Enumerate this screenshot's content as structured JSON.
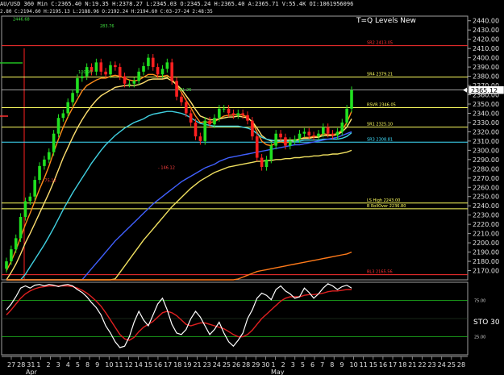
{
  "header": {
    "title_line": "AU/USD 360 Min  C:2365.40  N:19.35  H:2378.27  L:2345.03  O:2345.24  H:2365.40  A:2365.71  V:55.4K  OI:1061956096",
    "info_line": "2.80  C:2194.60  H:2195.13  L:2188.96  O:2192.24  H:2194.60  C:03-27-24  2:48:35"
  },
  "chart_data": {
    "type": "candlestick",
    "title": "T=Q Levels New",
    "instrument": "AU/USD",
    "timeframe": "360 Min",
    "ylim": [
      2160,
      2445
    ],
    "y_ticks": [
      2170,
      2180,
      2190,
      2200,
      2210,
      2220,
      2230,
      2240,
      2250,
      2260,
      2270,
      2280,
      2290,
      2300,
      2310,
      2320,
      2330,
      2340,
      2350,
      2360,
      2370,
      2380,
      2390,
      2400,
      2410,
      2420,
      2430,
      2440
    ],
    "last_price": "2365.12",
    "x_tick_labels": [
      "27",
      "28",
      "31",
      "1",
      "2",
      "3",
      "4",
      "5",
      "8",
      "9",
      "10",
      "11",
      "12",
      "14",
      "15",
      "16",
      "17",
      "18",
      "19",
      "21",
      "23",
      "24",
      "25",
      "26",
      "28",
      "29",
      "30",
      "1",
      "2",
      "3",
      "5",
      "6",
      "7",
      "8",
      "9",
      "10",
      "11",
      "15",
      "16",
      "17",
      "18",
      "21",
      "22",
      "23",
      "24",
      "25",
      "28"
    ],
    "month_labels": [
      "Apr",
      "May"
    ],
    "levels": [
      {
        "label": "SR2 2413.05",
        "value": 2413.05,
        "color": "#ff3030"
      },
      {
        "label": "SR4 2379.21",
        "value": 2379.21,
        "color": "#ffff60"
      },
      {
        "label": "RSVR 2346.05",
        "value": 2346.05,
        "color": "#ffff60"
      },
      {
        "label": "SR1 2325.10",
        "value": 2325.1,
        "color": "#ffff60"
      },
      {
        "label": "SR3 2308.81",
        "value": 2308.81,
        "color": "#40e0ff"
      },
      {
        "label": "LS High 2243.00",
        "value": 2243.0,
        "color": "#ffff60"
      },
      {
        "label": "B RollOver 2236.80",
        "value": 2236.8,
        "color": "#ffff60"
      },
      {
        "label": "BL3 2165.56",
        "value": 2165.56,
        "color": "#ff3030"
      }
    ],
    "annotations": [
      {
        "text": "2446.68",
        "x": "27",
        "y": 2440
      },
      {
        "text": "283.76",
        "x": "12",
        "y": 2433
      },
      {
        "text": "100.90",
        "x": "9",
        "y": 2383
      },
      {
        "text": "81.26",
        "x": "26",
        "y": 2364
      },
      {
        "text": "- 146.12",
        "x": "23",
        "y": 2280
      },
      {
        "text": "- 75.13",
        "x": "2",
        "y": 2266
      }
    ],
    "price_series": [
      {
        "name": "close",
        "values": [
          2180,
          2193,
          2205,
          2228,
          2245,
          2250,
          2268,
          2283,
          2290,
          2298,
          2318,
          2335,
          2340,
          2352,
          2362,
          2378,
          2380,
          2390,
          2385,
          2395,
          2385,
          2382,
          2392,
          2390,
          2380,
          2372,
          2372,
          2375,
          2385,
          2391,
          2400,
          2390,
          2382,
          2388,
          2395,
          2375,
          2358,
          2352,
          2340,
          2330,
          2315,
          2310,
          2332,
          2328,
          2335,
          2345,
          2345,
          2340,
          2338,
          2340,
          2338,
          2332,
          2315,
          2292,
          2282,
          2290,
          2305,
          2318,
          2314,
          2305,
          2310,
          2312,
          2318,
          2320,
          2316,
          2315,
          2318,
          2325,
          2318,
          2316,
          2320,
          2330,
          2345,
          2365
        ]
      }
    ],
    "moving_averages": [
      {
        "values": [
          2170,
          2180,
          2192,
          2206,
          2220,
          2232,
          2245,
          2258,
          2270,
          2283,
          2298,
          2312,
          2325,
          2336,
          2346,
          2355,
          2364,
          2370,
          2373,
          2376,
          2378,
          2378,
          2380,
          2381,
          2380,
          2378,
          2376,
          2375,
          2376,
          2379,
          2382,
          2382,
          2380,
          2380,
          2381,
          2377,
          2370,
          2363,
          2354,
          2346,
          2337,
          2330,
          2331,
          2330,
          2331,
          2334,
          2337,
          2338,
          2338,
          2339,
          2338,
          2336,
          2330,
          2320,
          2310,
          2306,
          2305,
          2308,
          2309,
          2308,
          2309,
          2310,
          2312,
          2314,
          2314,
          2315,
          2315,
          2318,
          2317,
          2317,
          2318,
          2322,
          2330,
          2342
        ],
        "color": "#ff8c1a"
      },
      {
        "values": [
          2160,
          2168,
          2177,
          2188,
          2200,
          2210,
          2221,
          2232,
          2243,
          2254,
          2266,
          2279,
          2292,
          2303,
          2314,
          2324,
          2333,
          2341,
          2348,
          2354,
          2359,
          2362,
          2365,
          2368,
          2369,
          2370,
          2370,
          2370,
          2371,
          2373,
          2376,
          2377,
          2377,
          2377,
          2378,
          2375,
          2371,
          2366,
          2359,
          2352,
          2344,
          2337,
          2335,
          2333,
          2333,
          2334,
          2335,
          2336,
          2336,
          2337,
          2336,
          2335,
          2331,
          2324,
          2316,
          2312,
          2310,
          2311,
          2311,
          2311,
          2311,
          2311,
          2312,
          2313,
          2313,
          2314,
          2314,
          2316,
          2316,
          2316,
          2317,
          2320,
          2325,
          2334
        ],
        "color": "#ffe070"
      },
      {
        "values": [
          2140,
          2145,
          2151,
          2158,
          2166,
          2174,
          2182,
          2190,
          2198,
          2207,
          2216,
          2226,
          2236,
          2245,
          2254,
          2262,
          2270,
          2278,
          2286,
          2293,
          2300,
          2306,
          2311,
          2316,
          2320,
          2324,
          2327,
          2330,
          2332,
          2334,
          2337,
          2339,
          2340,
          2341,
          2342,
          2342,
          2341,
          2340,
          2338,
          2335,
          2332,
          2329,
          2328,
          2327,
          2326,
          2326,
          2326,
          2326,
          2326,
          2326,
          2325,
          2324,
          2322,
          2318,
          2314,
          2312,
          2311,
          2310,
          2310,
          2310,
          2310,
          2310,
          2310,
          2311,
          2311,
          2311,
          2311,
          2312,
          2312,
          2312,
          2312,
          2313,
          2315,
          2319
        ],
        "color": "#40d0e0"
      },
      {
        "values": [
          2050,
          2056,
          2062,
          2068,
          2075,
          2082,
          2089,
          2096,
          2103,
          2110,
          2117,
          2124,
          2131,
          2138,
          2145,
          2152,
          2159,
          2166,
          2172,
          2178,
          2184,
          2190,
          2196,
          2202,
          2207,
          2212,
          2217,
          2222,
          2227,
          2232,
          2237,
          2242,
          2246,
          2250,
          2254,
          2258,
          2262,
          2266,
          2269,
          2272,
          2275,
          2278,
          2281,
          2283,
          2285,
          2288,
          2290,
          2292,
          2293,
          2294,
          2295,
          2296,
          2297,
          2298,
          2299,
          2300,
          2301,
          2302,
          2303,
          2304,
          2305,
          2306,
          2306,
          2307,
          2308,
          2309,
          2310,
          2311,
          2312,
          2313,
          2314,
          2316,
          2318,
          2320
        ],
        "color": "#4060ff"
      },
      {
        "values": [
          2015,
          2020,
          2025,
          2030,
          2035,
          2040,
          2046,
          2052,
          2058,
          2064,
          2070,
          2077,
          2084,
          2091,
          2098,
          2105,
          2112,
          2119,
          2126,
          2133,
          2140,
          2147,
          2154,
          2161,
          2168,
          2175,
          2182,
          2189,
          2196,
          2203,
          2209,
          2215,
          2221,
          2227,
          2233,
          2239,
          2244,
          2249,
          2254,
          2259,
          2263,
          2267,
          2270,
          2273,
          2276,
          2278,
          2280,
          2282,
          2283,
          2284,
          2285,
          2286,
          2287,
          2288,
          2288,
          2289,
          2289,
          2290,
          2290,
          2291,
          2291,
          2292,
          2292,
          2293,
          2293,
          2294,
          2294,
          2295,
          2295,
          2296,
          2296,
          2297,
          2298,
          2300
        ],
        "color": "#f0e060"
      },
      {
        "values": [
          1990,
          1992,
          1995,
          1998,
          2001,
          2004,
          2007,
          2010,
          2014,
          2018,
          2022,
          2026,
          2030,
          2034,
          2038,
          2042,
          2046,
          2050,
          2054,
          2058,
          2062,
          2066,
          2070,
          2074,
          2078,
          2082,
          2086,
          2090,
          2094,
          2098,
          2102,
          2106,
          2110,
          2114,
          2118,
          2122,
          2126,
          2129,
          2132,
          2135,
          2138,
          2141,
          2144,
          2147,
          2150,
          2153,
          2155,
          2157,
          2159,
          2161,
          2163,
          2165,
          2167,
          2169,
          2170,
          2171,
          2172,
          2173,
          2174,
          2175,
          2176,
          2177,
          2178,
          2179,
          2180,
          2181,
          2182,
          2183,
          2184,
          2185,
          2186,
          2187,
          2188,
          2190
        ],
        "color": "#ff7a1a"
      }
    ],
    "oscillator": {
      "label": "STO 30",
      "ticks": [
        "75.00",
        "25.00"
      ],
      "k_values": [
        62,
        70,
        80,
        92,
        95,
        92,
        96,
        97,
        95,
        97,
        96,
        94,
        96,
        97,
        95,
        90,
        86,
        80,
        72,
        65,
        55,
        40,
        30,
        18,
        10,
        12,
        25,
        45,
        60,
        48,
        40,
        55,
        70,
        78,
        62,
        42,
        30,
        28,
        35,
        50,
        60,
        52,
        40,
        28,
        35,
        45,
        30,
        18,
        12,
        20,
        30,
        50,
        62,
        78,
        85,
        82,
        76,
        90,
        95,
        88,
        84,
        78,
        80,
        92,
        86,
        78,
        84,
        92,
        98,
        95,
        90,
        94,
        96,
        92
      ],
      "d_values": [
        55,
        62,
        70,
        78,
        84,
        88,
        91,
        93,
        94,
        95,
        95,
        95,
        95,
        95,
        94,
        92,
        89,
        85,
        80,
        74,
        67,
        58,
        48,
        38,
        28,
        22,
        20,
        24,
        32,
        38,
        42,
        46,
        52,
        58,
        60,
        58,
        54,
        48,
        42,
        40,
        42,
        44,
        44,
        42,
        40,
        38,
        36,
        32,
        28,
        25,
        25,
        28,
        34,
        42,
        50,
        56,
        62,
        68,
        74,
        78,
        80,
        80,
        80,
        82,
        83,
        83,
        84,
        85,
        87,
        88,
        88,
        89,
        90,
        90
      ],
      "k_color": "#ffffff",
      "d_color": "#e02020"
    }
  }
}
